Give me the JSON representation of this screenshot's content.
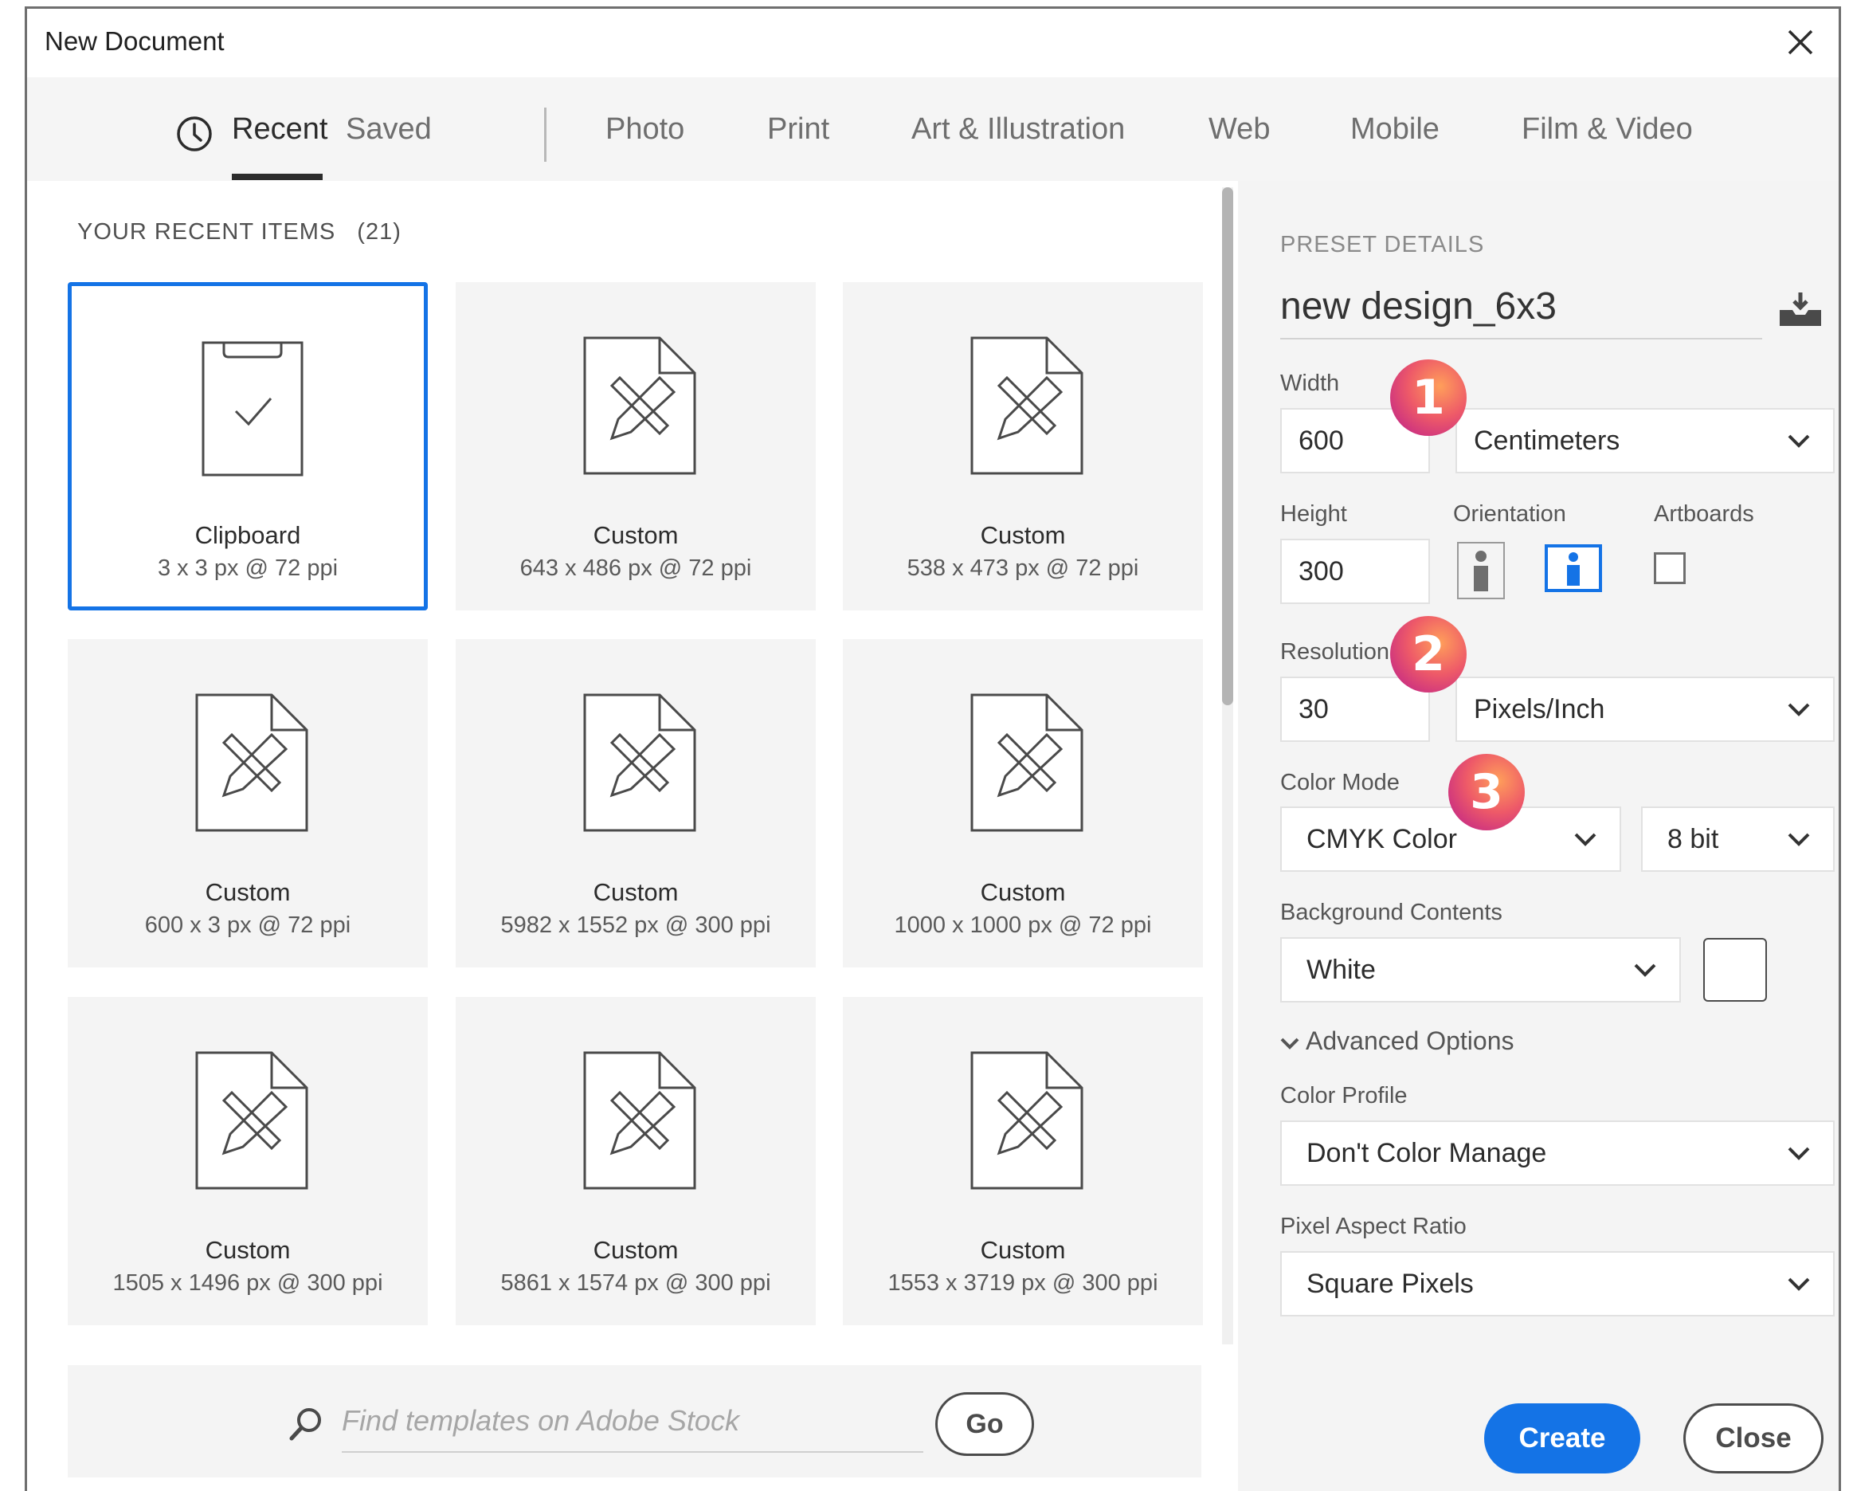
{
  "window": {
    "title": "New Document"
  },
  "tabs": [
    {
      "label": "Recent",
      "active": true,
      "icon": "clock-icon"
    },
    {
      "label": "Saved"
    },
    {
      "label": "Photo"
    },
    {
      "label": "Print"
    },
    {
      "label": "Art & Illustration"
    },
    {
      "label": "Web"
    },
    {
      "label": "Mobile"
    },
    {
      "label": "Film & Video"
    }
  ],
  "recent": {
    "heading": "YOUR RECENT ITEMS",
    "count": "(21)",
    "items": [
      {
        "name": "Clipboard",
        "dims": "3 x 3 px @ 72 ppi",
        "icon": "clipboard-icon",
        "selected": true
      },
      {
        "name": "Custom",
        "dims": "643 x 486 px @ 72 ppi",
        "icon": "custom-document-icon"
      },
      {
        "name": "Custom",
        "dims": "538 x 473 px @ 72 ppi",
        "icon": "custom-document-icon"
      },
      {
        "name": "Custom",
        "dims": "600 x 3 px @ 72 ppi",
        "icon": "custom-document-icon"
      },
      {
        "name": "Custom",
        "dims": "5982 x 1552 px @ 300 ppi",
        "icon": "custom-document-icon"
      },
      {
        "name": "Custom",
        "dims": "1000 x 1000 px @ 72 ppi",
        "icon": "custom-document-icon"
      },
      {
        "name": "Custom",
        "dims": "1505 x 1496 px @ 300 ppi",
        "icon": "custom-document-icon"
      },
      {
        "name": "Custom",
        "dims": "5861 x 1574 px @ 300 ppi",
        "icon": "custom-document-icon"
      },
      {
        "name": "Custom",
        "dims": "1553 x 3719 px @ 300 ppi",
        "icon": "custom-document-icon"
      }
    ]
  },
  "search": {
    "placeholder": "Find templates on Adobe Stock",
    "go_label": "Go"
  },
  "preset": {
    "heading": "PRESET DETAILS",
    "name": "new design_6x3",
    "width_label": "Width",
    "width_value": "600",
    "width_unit": "Centimeters",
    "height_label": "Height",
    "height_value": "300",
    "orientation_label": "Orientation",
    "artboards_label": "Artboards",
    "resolution_label": "Resolution",
    "resolution_value": "30",
    "resolution_unit": "Pixels/Inch",
    "color_mode_label": "Color Mode",
    "color_mode_value": "CMYK Color",
    "bit_depth_value": "8 bit",
    "background_label": "Background Contents",
    "background_value": "White",
    "advanced_label": "Advanced Options",
    "color_profile_label": "Color Profile",
    "color_profile_value": "Don't Color Manage",
    "pixel_aspect_label": "Pixel Aspect Ratio",
    "pixel_aspect_value": "Square Pixels",
    "create_label": "Create",
    "close_label": "Close"
  },
  "callouts": [
    "1",
    "2",
    "3"
  ],
  "colors": {
    "accent": "#1473e6",
    "badge_start": "#ff9f5a",
    "badge_end": "#b81a8e"
  }
}
